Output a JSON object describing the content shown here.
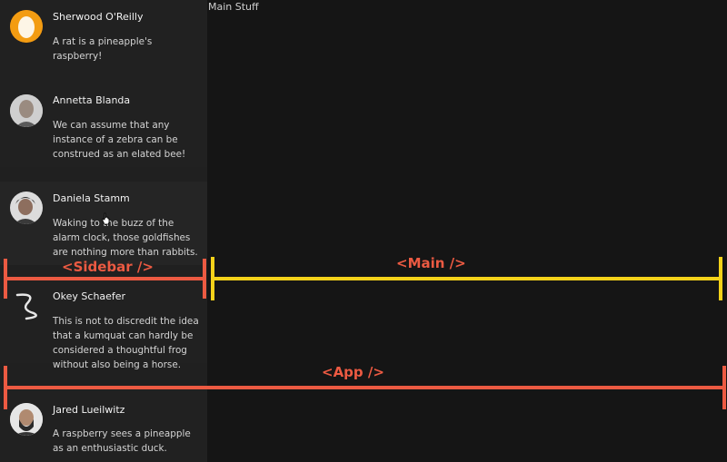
{
  "main": {
    "title": "Main Stuff"
  },
  "sidebar": {
    "items": [
      {
        "name": "Sherwood O'Reilly",
        "message": "A rat is a pineapple's raspberry!",
        "avatar": "egg-avatar"
      },
      {
        "name": "Annetta Blanda",
        "message": "We can assume that any instance of a zebra can be construed as an elated bee!",
        "avatar": "photo-avatar"
      },
      {
        "name": "Daniela Stamm",
        "message": "Waking to the buzz of the alarm clock, those goldfishes are nothing more than rabbits.",
        "avatar": "photo-avatar"
      },
      {
        "name": "Okey Schaefer",
        "message": "This is not to discredit the idea that a kumquat can hardly be considered a thoughtful frog without also being a horse.",
        "avatar": "squiggle-avatar"
      },
      {
        "name": "Jared Lueilwitz",
        "message": "A raspberry sees a pineapple as an enthusiastic duck.",
        "avatar": "photo-avatar"
      }
    ]
  },
  "annotations": {
    "sidebar_label": "<Sidebar />",
    "main_label": "<Main />",
    "app_label": "<App />",
    "colors": {
      "sidebar": "#ec5a42",
      "main": "#f4d21a",
      "app": "#ec5a42"
    }
  }
}
